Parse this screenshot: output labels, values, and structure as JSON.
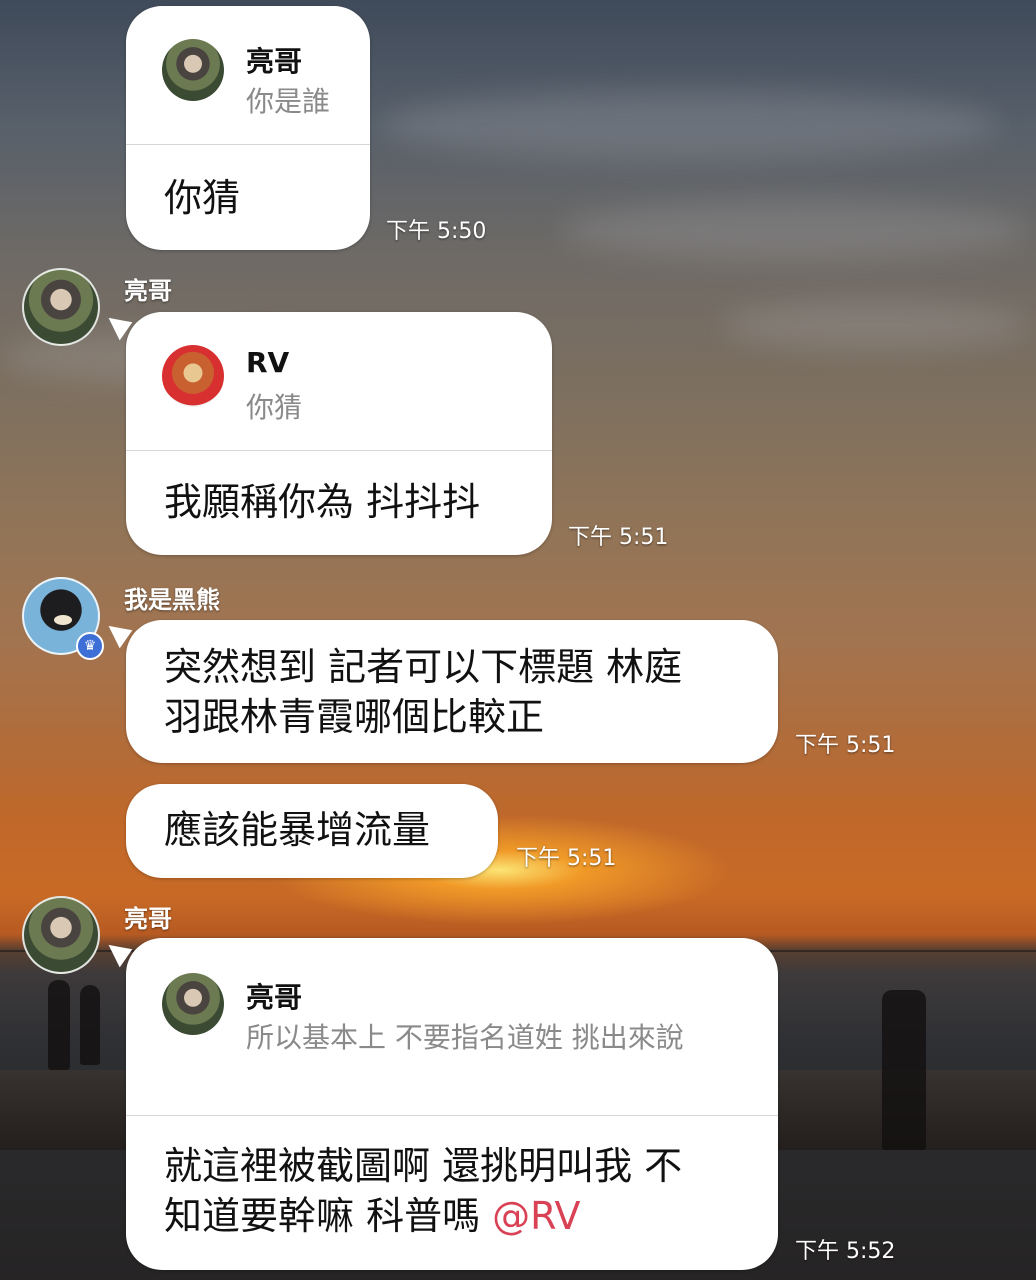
{
  "messages": [
    {
      "reply_to": {
        "name": "亮哥",
        "text": "你是誰"
      },
      "text": "你猜",
      "time": "下午 5:50"
    },
    {
      "sender": "亮哥",
      "reply_to": {
        "name": "RV",
        "text": "你猜"
      },
      "text": "我願稱你為 抖抖抖",
      "time": "下午 5:51"
    },
    {
      "sender": "我是黑熊",
      "lines": [
        "突然想到 記者可以下標題 林庭",
        "羽跟林青霞哪個比較正"
      ],
      "time": "下午 5:51"
    },
    {
      "text": "應該能暴增流量",
      "time": "下午 5:51"
    },
    {
      "sender": "亮哥",
      "reply_to": {
        "name": "亮哥",
        "text": "所以基本上 不要指名道姓 挑出來說"
      },
      "lines": [
        "就這裡被截圖啊 還挑明叫我 不",
        "知道要幹嘛 科普嗎 "
      ],
      "mention": "@RV",
      "time": "下午 5:52"
    }
  ],
  "icons": {
    "crown": "crown-icon"
  },
  "colors": {
    "mention": "#d94155",
    "bubble": "#ffffff",
    "badge": "#3d6fd6"
  }
}
